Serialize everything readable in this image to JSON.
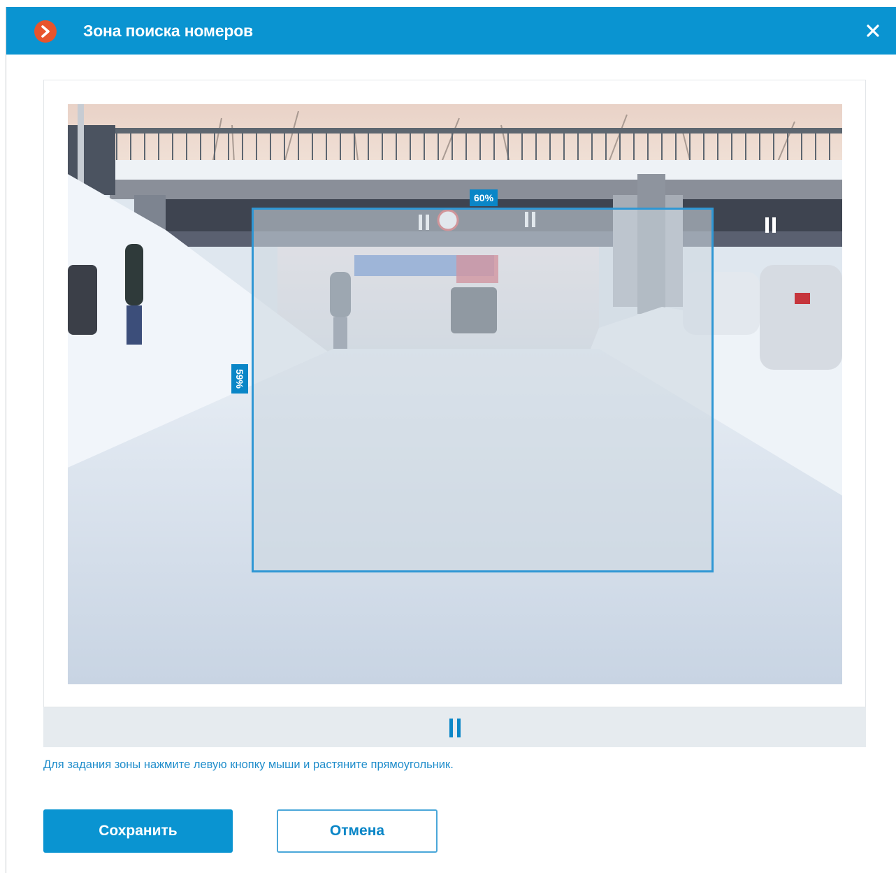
{
  "dialog": {
    "title": "Зона поиска номеров",
    "app_icon": "chevron-right-logo",
    "close_icon": "close-icon"
  },
  "zone": {
    "width_label": "60%",
    "height_label": "59%",
    "width_fraction": 0.6,
    "height_fraction": 0.59
  },
  "player": {
    "pause_icon": "pause-icon"
  },
  "hint": "Для задания зоны нажмите левую кнопку мыши и растяните прямоугольник.",
  "buttons": {
    "save": "Сохранить",
    "cancel": "Отмена"
  },
  "colors": {
    "accent": "#0a94d1",
    "logo": "#e8542c",
    "zone_border": "#2f97d4",
    "control_bar": "#e6ebef"
  }
}
